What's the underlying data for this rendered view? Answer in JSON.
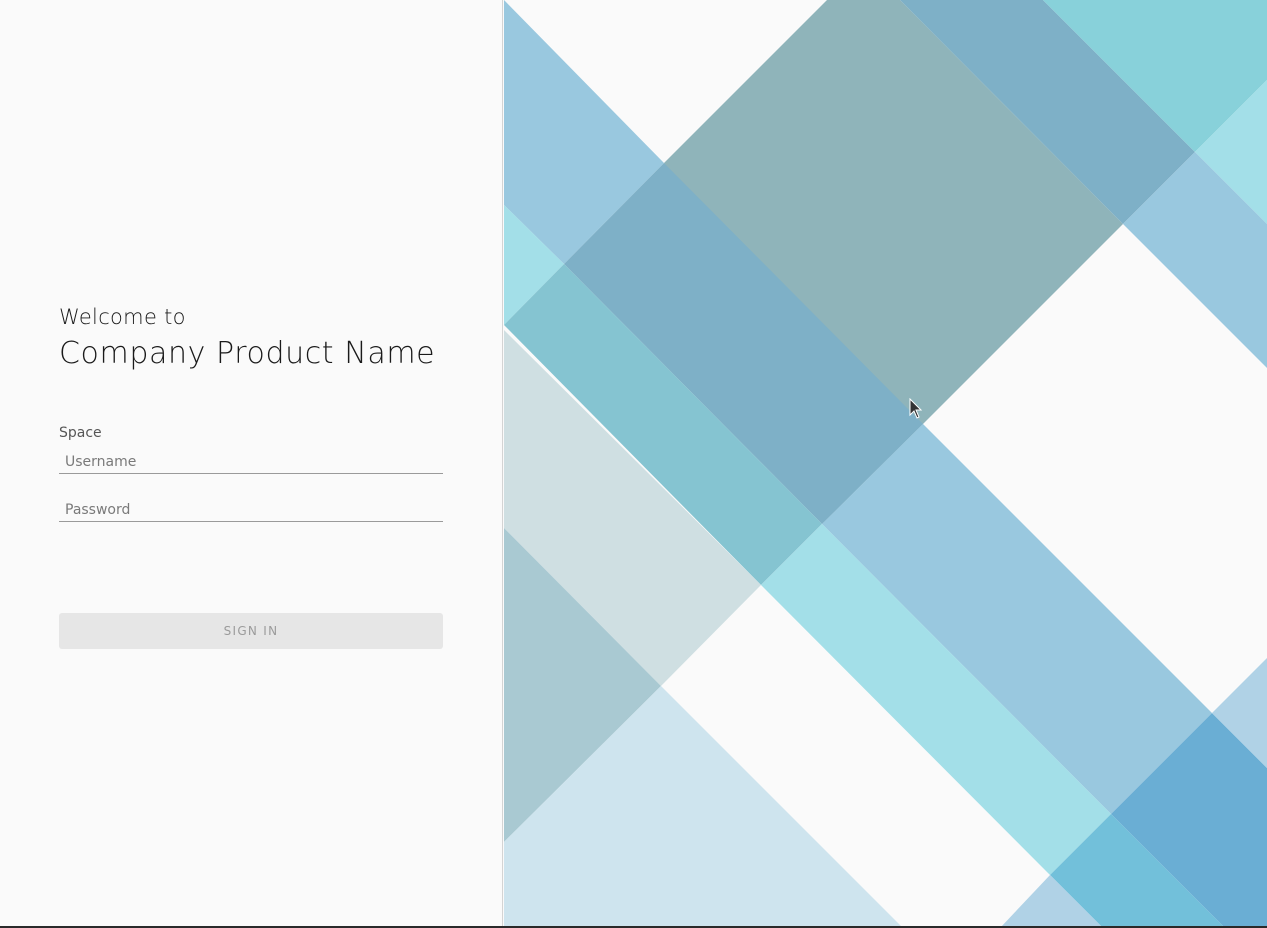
{
  "login": {
    "welcome": "Welcome to",
    "product_name": "Company Product Name",
    "space_label": "Space",
    "username_placeholder": "Username",
    "password_placeholder": "Password",
    "sign_in_label": "SIGN IN"
  },
  "colors": {
    "background": "#fafafa",
    "button_bg": "#e6e6e6",
    "button_text": "#9b9b9b",
    "pattern_light_blue": "#99c8df",
    "pattern_teal": "#8fb4ba",
    "pattern_steel": "#7eb0c7",
    "pattern_aqua": "#a3dfe8",
    "pattern_mid_blue": "#6aaed4"
  },
  "icons": {
    "cursor": "mouse-pointer-icon"
  }
}
